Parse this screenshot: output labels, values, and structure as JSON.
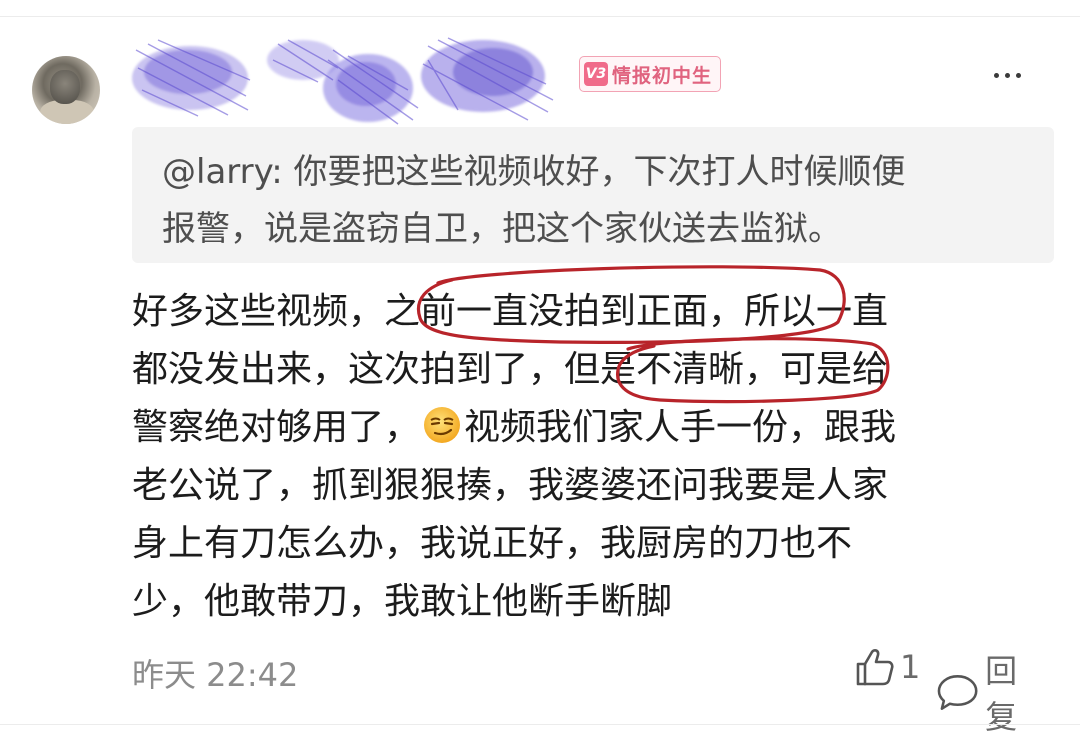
{
  "comment": {
    "badge": {
      "level": "V3",
      "label": "情报初中生"
    },
    "quote": {
      "lines": [
        "@larry: 你要把这些视频收好，下次打人时候顺便",
        "报警，说是盗窃自卫，把这个家伙送去监狱。"
      ]
    },
    "body": {
      "line1_a": "好多这些视频，",
      "line1_b": "之前一直没拍到正面，",
      "line1_c": "所以一直",
      "line2_a": "都没发出来，这次拍到了，",
      "line2_b": "但是不清晰，",
      "line2_c": "可是给",
      "line3_a": "警察绝对够用了，",
      "line3_b": "视频我们家人手一份，跟我",
      "line4": "老公说了，抓到狠狠揍，我婆婆还问我要是人家",
      "line5": "身上有刀怎么办，我说正好，我厨房的刀也不",
      "line6": "少，他敢带刀，我敢让他断手断脚"
    },
    "emoji": "smirk-emoji",
    "timestamp": "昨天 22:42",
    "like_count": "1",
    "reply_label": "回复"
  },
  "colors": {
    "annotation_red": "#b8242a",
    "badge_pink": "#f06b8a",
    "scribble_purple": "#6b5bd6"
  }
}
